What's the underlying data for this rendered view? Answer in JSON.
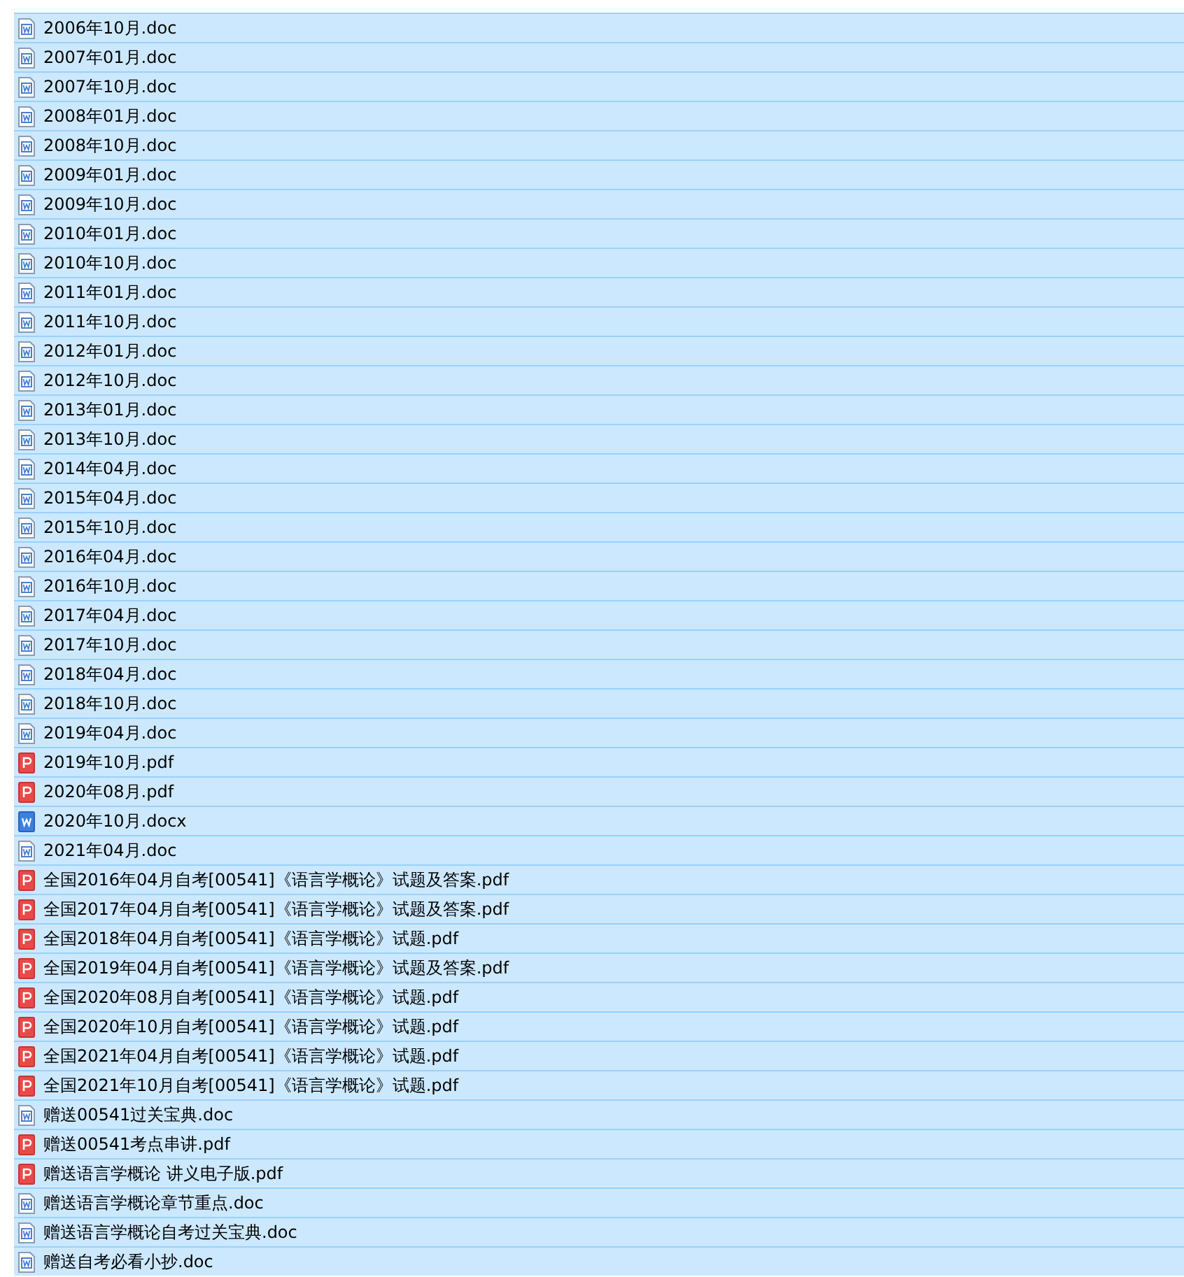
{
  "files": [
    {
      "name": "2006年10月.doc",
      "kind": "doc",
      "selected": true
    },
    {
      "name": "2007年01月.doc",
      "kind": "doc",
      "selected": true
    },
    {
      "name": "2007年10月.doc",
      "kind": "doc",
      "selected": true
    },
    {
      "name": "2008年01月.doc",
      "kind": "doc",
      "selected": true
    },
    {
      "name": "2008年10月.doc",
      "kind": "doc",
      "selected": true
    },
    {
      "name": "2009年01月.doc",
      "kind": "doc",
      "selected": true
    },
    {
      "name": "2009年10月.doc",
      "kind": "doc",
      "selected": true
    },
    {
      "name": "2010年01月.doc",
      "kind": "doc",
      "selected": true
    },
    {
      "name": "2010年10月.doc",
      "kind": "doc",
      "selected": true
    },
    {
      "name": "2011年01月.doc",
      "kind": "doc",
      "selected": true
    },
    {
      "name": "2011年10月.doc",
      "kind": "doc",
      "selected": true
    },
    {
      "name": "2012年01月.doc",
      "kind": "doc",
      "selected": true
    },
    {
      "name": "2012年10月.doc",
      "kind": "doc",
      "selected": true
    },
    {
      "name": "2013年01月.doc",
      "kind": "doc",
      "selected": true
    },
    {
      "name": "2013年10月.doc",
      "kind": "doc",
      "selected": true
    },
    {
      "name": "2014年04月.doc",
      "kind": "doc",
      "selected": true
    },
    {
      "name": "2015年04月.doc",
      "kind": "doc",
      "selected": true
    },
    {
      "name": "2015年10月.doc",
      "kind": "doc",
      "selected": true
    },
    {
      "name": "2016年04月.doc",
      "kind": "doc",
      "selected": true
    },
    {
      "name": "2016年10月.doc",
      "kind": "doc",
      "selected": true
    },
    {
      "name": "2017年04月.doc",
      "kind": "doc",
      "selected": true
    },
    {
      "name": "2017年10月.doc",
      "kind": "doc",
      "selected": true
    },
    {
      "name": "2018年04月.doc",
      "kind": "doc",
      "selected": true
    },
    {
      "name": "2018年10月.doc",
      "kind": "doc",
      "selected": true
    },
    {
      "name": "2019年04月.doc",
      "kind": "doc",
      "selected": true
    },
    {
      "name": "2019年10月.pdf",
      "kind": "pdf",
      "selected": true
    },
    {
      "name": "2020年08月.pdf",
      "kind": "pdf",
      "selected": true
    },
    {
      "name": "2020年10月.docx",
      "kind": "docx",
      "selected": true
    },
    {
      "name": "2021年04月.doc",
      "kind": "doc",
      "selected": true
    },
    {
      "name": "全国2016年04月自考[00541]《语言学概论》试题及答案.pdf",
      "kind": "pdf",
      "selected": true
    },
    {
      "name": "全国2017年04月自考[00541]《语言学概论》试题及答案.pdf",
      "kind": "pdf",
      "selected": true
    },
    {
      "name": "全国2018年04月自考[00541]《语言学概论》试题.pdf",
      "kind": "pdf",
      "selected": true
    },
    {
      "name": "全国2019年04月自考[00541]《语言学概论》试题及答案.pdf",
      "kind": "pdf",
      "selected": true
    },
    {
      "name": "全国2020年08月自考[00541]《语言学概论》试题.pdf",
      "kind": "pdf",
      "selected": true
    },
    {
      "name": "全国2020年10月自考[00541]《语言学概论》试题.pdf",
      "kind": "pdf",
      "selected": true
    },
    {
      "name": "全国2021年04月自考[00541]《语言学概论》试题.pdf",
      "kind": "pdf",
      "selected": true
    },
    {
      "name": "全国2021年10月自考[00541]《语言学概论》试题.pdf",
      "kind": "pdf",
      "selected": true
    },
    {
      "name": "赠送00541过关宝典.doc",
      "kind": "doc",
      "selected": true
    },
    {
      "name": "赠送00541考点串讲.pdf",
      "kind": "pdf",
      "selected": true
    },
    {
      "name": "赠送语言学概论 讲义电子版.pdf",
      "kind": "pdf",
      "selected": true
    },
    {
      "name": "赠送语言学概论章节重点.doc",
      "kind": "doc",
      "selected": true
    },
    {
      "name": "赠送语言学概论自考过关宝典.doc",
      "kind": "doc",
      "selected": true
    },
    {
      "name": "赠送自考必看小抄.doc",
      "kind": "doc",
      "selected": true
    }
  ]
}
